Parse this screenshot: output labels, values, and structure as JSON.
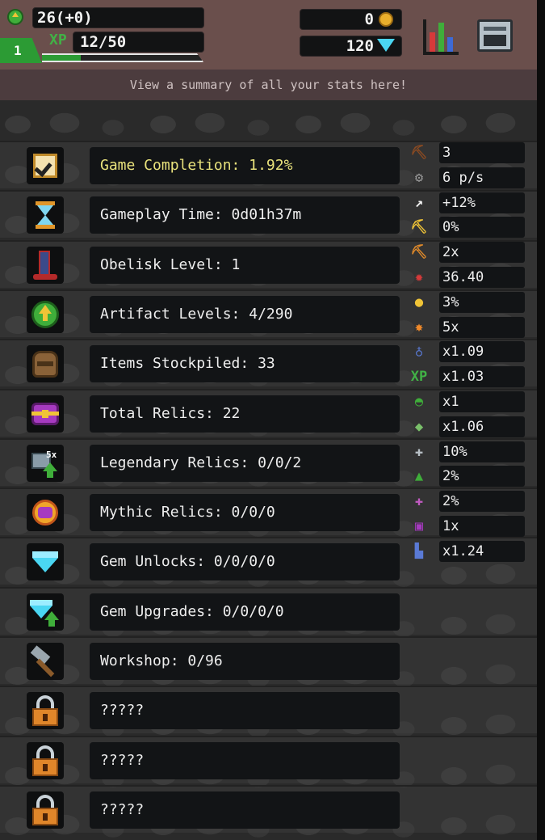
{
  "hud": {
    "level_text": "26(+0)",
    "xp_label": "XP",
    "xp_text": "12/50",
    "xp_fraction": 0.24,
    "level_tab": "1",
    "coins": "0",
    "gems": "120"
  },
  "hint": "View a summary of all your stats here!",
  "rows": [
    {
      "label": "Game Completion: 1.92%",
      "icon": "checkbox-icon",
      "highlight": true
    },
    {
      "label": "Gameplay Time: 0d01h37m",
      "icon": "hourglass-icon",
      "highlight": false
    },
    {
      "label": "Obelisk Level: 1",
      "icon": "obelisk-icon",
      "highlight": false
    },
    {
      "label": "Artifact Levels: 4/290",
      "icon": "artifact-arrow-icon",
      "highlight": false
    },
    {
      "label": "Items Stockpiled: 33",
      "icon": "sack-icon",
      "highlight": false
    },
    {
      "label": "Total Relics: 22",
      "icon": "chest-icon",
      "highlight": false
    },
    {
      "label": "Legendary Relics: 0/0/2",
      "icon": "legendary-relic-icon",
      "highlight": false
    },
    {
      "label": "Mythic Relics: 0/0/0",
      "icon": "mythic-relic-icon",
      "highlight": false
    },
    {
      "label": "Gem Unlocks: 0/0/0/0",
      "icon": "gem-icon",
      "highlight": false
    },
    {
      "label": "Gem Upgrades: 0/0/0/0",
      "icon": "gem-upgrade-icon",
      "highlight": false
    },
    {
      "label": "Workshop: 0/96",
      "icon": "hammer-icon",
      "highlight": false
    },
    {
      "label": "?????",
      "icon": "padlock-icon",
      "highlight": false
    },
    {
      "label": "?????",
      "icon": "padlock-icon",
      "highlight": false
    },
    {
      "label": "?????",
      "icon": "padlock-icon",
      "highlight": false
    }
  ],
  "side_stats": [
    {
      "icon": "pickaxe-icon",
      "value": "3"
    },
    {
      "icon": "auto-miner-icon",
      "value": "6 p/s"
    },
    {
      "icon": "white-pickaxe-icon",
      "value": "+12%"
    },
    {
      "icon": "gold-pickaxe-icon",
      "value": "0%"
    },
    {
      "icon": "crit-pickaxe-icon",
      "value": "2x"
    },
    {
      "icon": "damage-burst-icon",
      "value": "36.40"
    },
    {
      "icon": "bomb-icon",
      "value": "3%"
    },
    {
      "icon": "fire-icon",
      "value": "5x"
    },
    {
      "icon": "potion-icon",
      "value": "x1.09"
    },
    {
      "icon": "xp-icon",
      "value": "x1.03"
    },
    {
      "icon": "helmet-icon",
      "value": "x1"
    },
    {
      "icon": "ore-icon",
      "value": "x1.06"
    },
    {
      "icon": "miner-plus-icon",
      "value": "10%"
    },
    {
      "icon": "upgrade-arrow-icon",
      "value": "2%"
    },
    {
      "icon": "relic-plus-icon",
      "value": "2%"
    },
    {
      "icon": "relic-multi-icon",
      "value": "1x"
    },
    {
      "icon": "speed-boot-icon",
      "value": "x1.24"
    }
  ],
  "colors": {
    "hud": "#6a4f4c",
    "xp_green": "#2c9b34",
    "highlight_text": "#e9e27c",
    "gem": "#4ad6f2",
    "coin": "#e8ae2c"
  }
}
